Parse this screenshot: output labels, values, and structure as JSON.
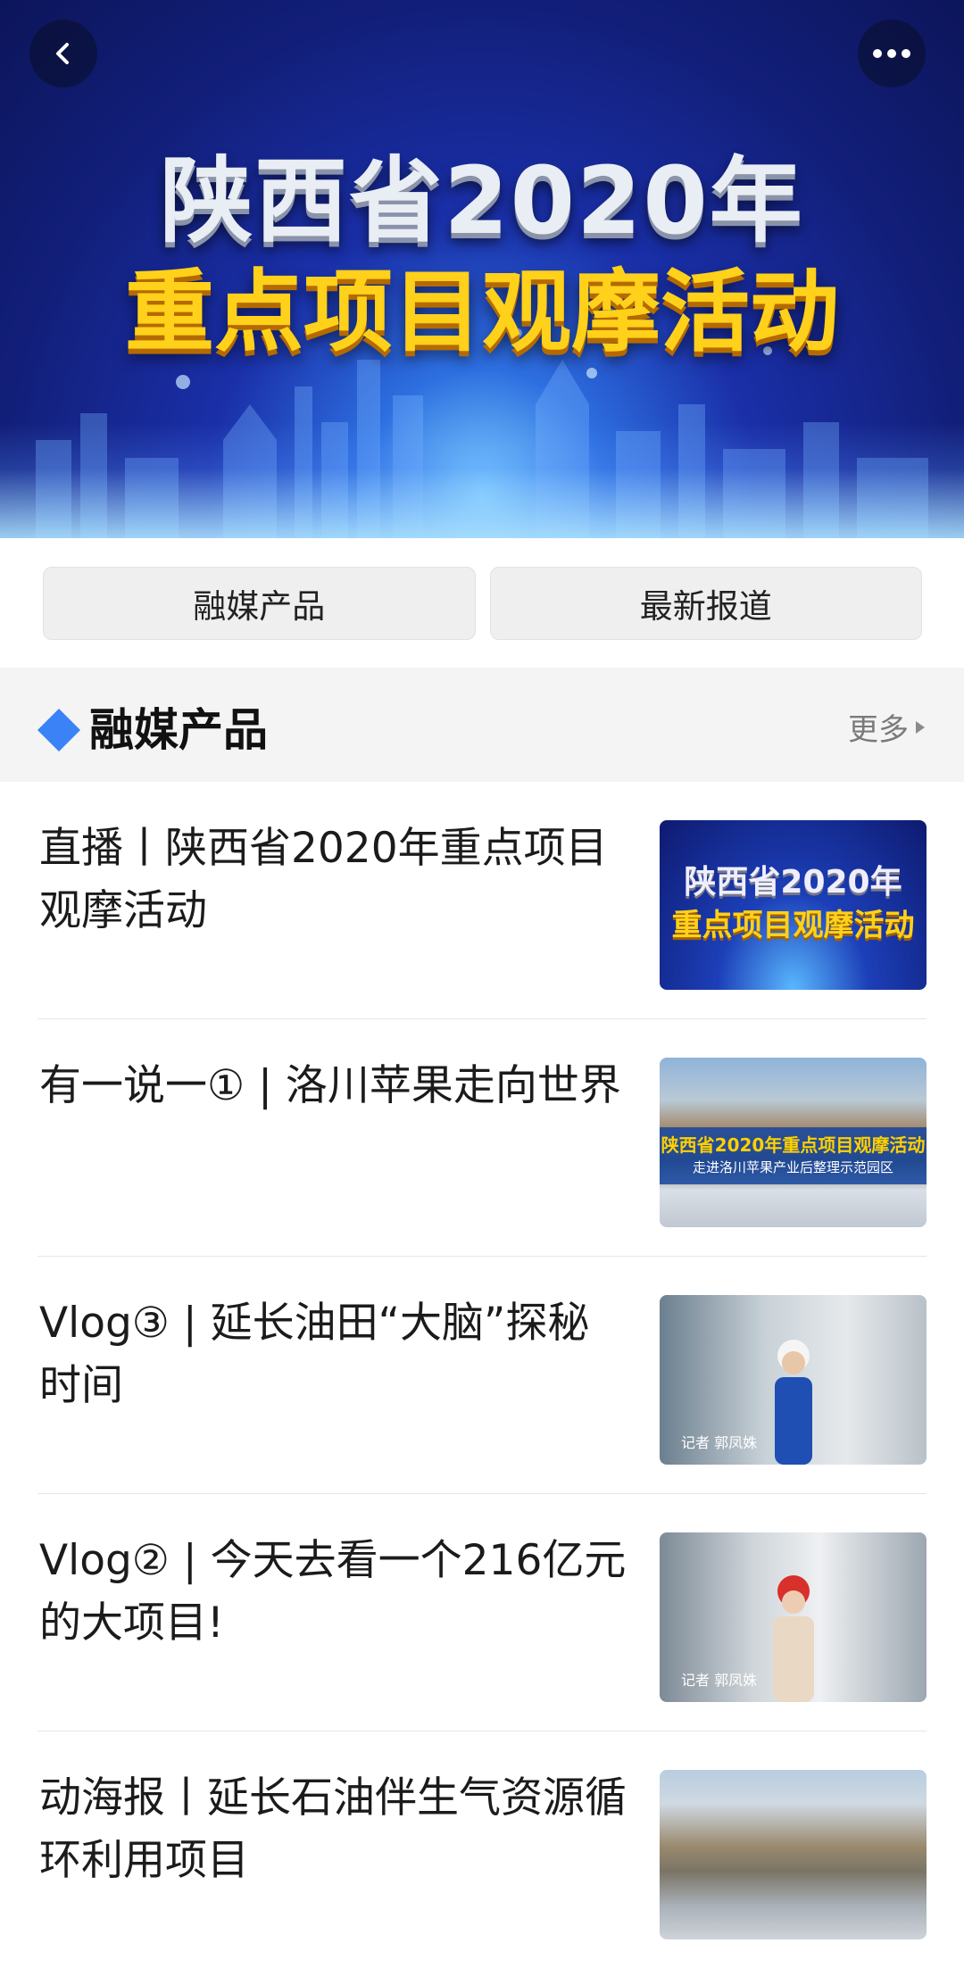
{
  "hero": {
    "title_line1": "陕西省2020年",
    "title_line2": "重点项目观摩活动",
    "back_icon": "chevron-left-icon",
    "more_icon": "ellipsis-icon"
  },
  "tabs": [
    {
      "label": "融媒产品"
    },
    {
      "label": "最新报道"
    }
  ],
  "section": {
    "title": "融媒产品",
    "more_label": "更多",
    "accent_color": "#3b82f6"
  },
  "items": [
    {
      "title": "直播丨陕西省2020年重点项目观摩活动",
      "thumb_line1": "陕西省2020年",
      "thumb_line2": "重点项目观摩活动"
    },
    {
      "title": "有一说一①  |  洛川苹果走向世界",
      "thumb_line1": "陕西省2020年重点项目观摩活动",
      "thumb_line2": "走进洛川苹果产业后整理示范园区"
    },
    {
      "title": "Vlog③  |  延长油田“大脑”探秘时间",
      "thumb_caption": "记者 郭凤姝"
    },
    {
      "title": "Vlog②  |  今天去看一个216亿元的大项目!",
      "thumb_caption": "记者 郭凤姝"
    },
    {
      "title": "动海报丨延长石油伴生气资源循环利用项目"
    }
  ]
}
